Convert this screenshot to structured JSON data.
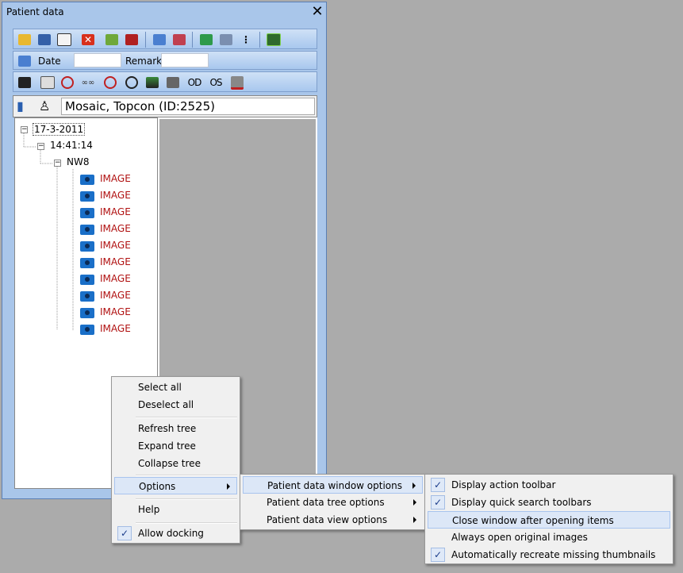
{
  "window": {
    "title": "Patient data",
    "close_icon": "close-icon"
  },
  "search": {
    "date_label": "Date",
    "date_value": "",
    "remark_label": "Remark",
    "remark_value": ""
  },
  "patient": {
    "name": "Mosaic, Topcon  (ID:2525)"
  },
  "tree": {
    "date": "17-3-2011",
    "time": "14:41:14",
    "group": "NW8",
    "images": [
      "IMAGE",
      "IMAGE",
      "IMAGE",
      "IMAGE",
      "IMAGE",
      "IMAGE",
      "IMAGE",
      "IMAGE",
      "IMAGE",
      "IMAGE"
    ]
  },
  "context_menu": {
    "select_all": "Select all",
    "deselect_all": "Deselect all",
    "refresh_tree": "Refresh tree",
    "expand_tree": "Expand tree",
    "collapse_tree": "Collapse tree",
    "options": "Options",
    "help": "Help",
    "allow_docking": "Allow docking",
    "allow_docking_checked": true
  },
  "options_menu": {
    "window_options": "Patient data window options",
    "tree_options": "Patient data tree options",
    "view_options": "Patient data view options"
  },
  "window_options_menu": {
    "items": [
      {
        "label": "Display action toolbar",
        "checked": true
      },
      {
        "label": "Display quick search toolbars",
        "checked": true
      },
      {
        "label": "Close window after opening items",
        "checked": false
      },
      {
        "label": "Always open original images",
        "checked": false
      },
      {
        "label": "Automatically recreate missing thumbnails",
        "checked": true
      }
    ]
  },
  "toolbar1_icons": [
    "open-folder-icon",
    "print-icon",
    "search-document-icon",
    "delete-icon",
    "edit-icon",
    "report-icon",
    "check-icon",
    "transfer-icon",
    "refresh-icon",
    "tree-icon",
    "more-icon",
    "settings-icon"
  ],
  "toolbar2_icons": [
    "video-icon",
    "stereo-icon",
    "fundus-icon",
    "bino-icon",
    "target-icon",
    "eye-icon",
    "layer-icon",
    "grid-icon",
    "od-icon",
    "os-icon",
    "grid-delete-icon"
  ],
  "colors": {
    "window": "#a9c6ea",
    "desktop": "#ababab",
    "image_label": "#b01010",
    "highlight": "#dce7f7"
  }
}
